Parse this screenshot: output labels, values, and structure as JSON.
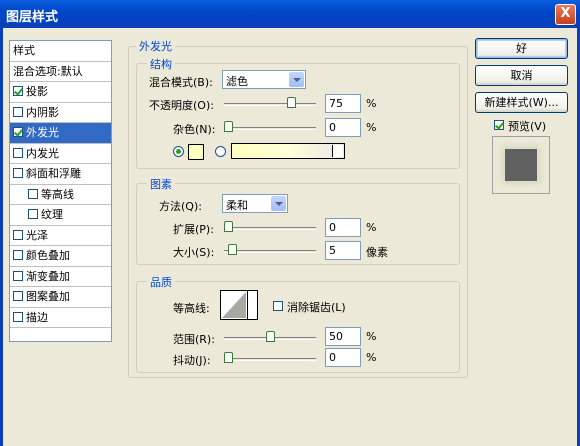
{
  "window": {
    "title": "图层样式",
    "close": "X"
  },
  "left_panel": {
    "items": [
      {
        "label": "样式",
        "checkbox": false,
        "checked": false
      },
      {
        "label": "混合选项:默认",
        "checkbox": false,
        "checked": false
      },
      {
        "label": "投影",
        "checkbox": true,
        "checked": true
      },
      {
        "label": "内阴影",
        "checkbox": true,
        "checked": false
      },
      {
        "label": "外发光",
        "checkbox": true,
        "checked": true,
        "selected": true
      },
      {
        "label": "内发光",
        "checkbox": true,
        "checked": false
      },
      {
        "label": "斜面和浮雕",
        "checkbox": true,
        "checked": false
      },
      {
        "label": "等高线",
        "checkbox": true,
        "checked": false
      },
      {
        "label": "纹理",
        "checkbox": true,
        "checked": false
      },
      {
        "label": "光泽",
        "checkbox": true,
        "checked": false
      },
      {
        "label": "颜色叠加",
        "checkbox": true,
        "checked": false
      },
      {
        "label": "渐变叠加",
        "checkbox": true,
        "checked": false
      },
      {
        "label": "图案叠加",
        "checkbox": true,
        "checked": false
      },
      {
        "label": "描边",
        "checkbox": true,
        "checked": false
      }
    ]
  },
  "outer_glow": {
    "title": "外发光",
    "structure": {
      "title": "结构",
      "blend_mode_label": "混合模式(B):",
      "blend_mode_value": "滤色",
      "opacity_label": "不透明度(O):",
      "opacity_value": "75",
      "opacity_unit": "%",
      "opacity_level": 0.75,
      "noise_label": "杂色(N):",
      "noise_value": "0",
      "noise_unit": "%",
      "noise_level": 0,
      "color_swatch": "#ffffc0"
    },
    "elements": {
      "title": "图素",
      "technique_label": "方法(Q):",
      "technique_value": "柔和",
      "spread_label": "扩展(P):",
      "spread_value": "0",
      "spread_unit": "%",
      "spread_level": 0,
      "size_label": "大小(S):",
      "size_value": "5",
      "size_unit": "像素",
      "size_level": 0.05
    },
    "quality": {
      "title": "品质",
      "contour_label": "等高线:",
      "antialias_label": "消除锯齿(L)",
      "range_label": "范围(R):",
      "range_value": "50",
      "range_unit": "%",
      "range_level": 0.5,
      "jitter_label": "抖动(J):",
      "jitter_value": "0",
      "jitter_unit": "%",
      "jitter_level": 0
    }
  },
  "buttons": {
    "ok": "好",
    "cancel": "取消",
    "new_style": "新建样式(W)...",
    "preview_label": "预览(V)"
  }
}
